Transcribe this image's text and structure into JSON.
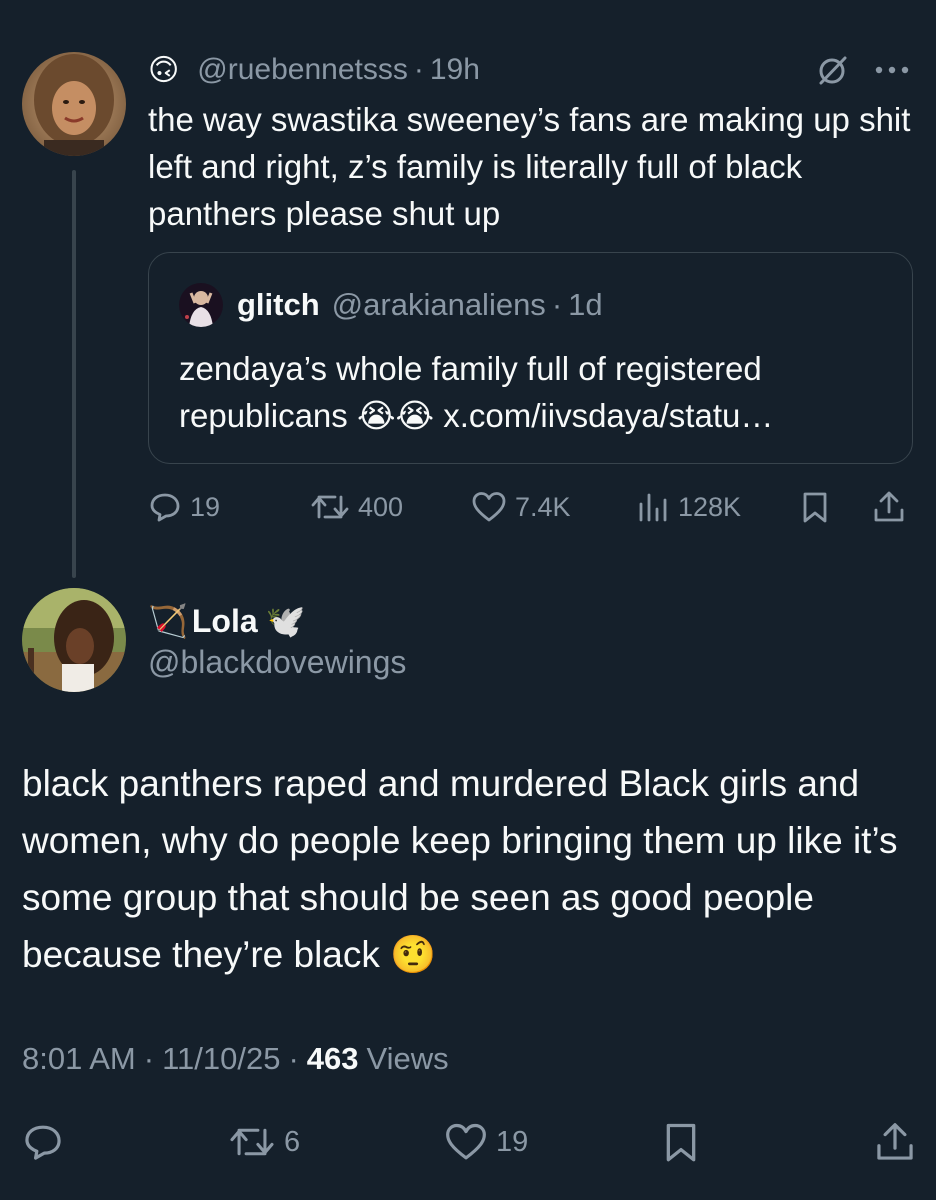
{
  "thread": {
    "tweet1": {
      "author": {
        "badge_emoji": "🙃",
        "handle": "@ruebennetsss",
        "time": "19h"
      },
      "text": "the way swastika sweeney’s fans are making up shit left and right, z’s family is literally full of black panthers please shut up",
      "quoted": {
        "name": "glitch",
        "handle": "@arakianaliens",
        "time": "1d",
        "text": "zendaya’s whole family full of registered republicans 😭😭 x.com/iivsdaya/statu…"
      },
      "stats": {
        "replies": "19",
        "reposts": "400",
        "likes": "7.4K",
        "views": "128K"
      },
      "icons": [
        "muted-circle-icon",
        "more-icon",
        "reply-icon",
        "repost-icon",
        "like-icon",
        "views-icon",
        "bookmark-icon",
        "share-icon"
      ]
    },
    "tweet2": {
      "author": {
        "name_prefix_emoji": "🏹",
        "name": "Lola",
        "name_suffix_emoji": "🕊️",
        "handle": "@blackdovewings"
      },
      "text": "black panthers raped and murdered Black girls and women, why do people keep bringing them up like it’s some group that should be seen as good people because they’re black 🤨",
      "meta": {
        "time": "8:01 AM",
        "date": "11/10/25",
        "views_count": "463",
        "views_label": "Views"
      },
      "stats": {
        "reposts": "6",
        "likes": "19"
      },
      "icons": [
        "reply-icon",
        "repost-icon",
        "like-icon",
        "bookmark-icon",
        "share-icon"
      ]
    }
  },
  "colors": {
    "background": "#15202b",
    "text": "#f7f9f9",
    "muted": "#8b98a5",
    "border": "#38444d"
  }
}
